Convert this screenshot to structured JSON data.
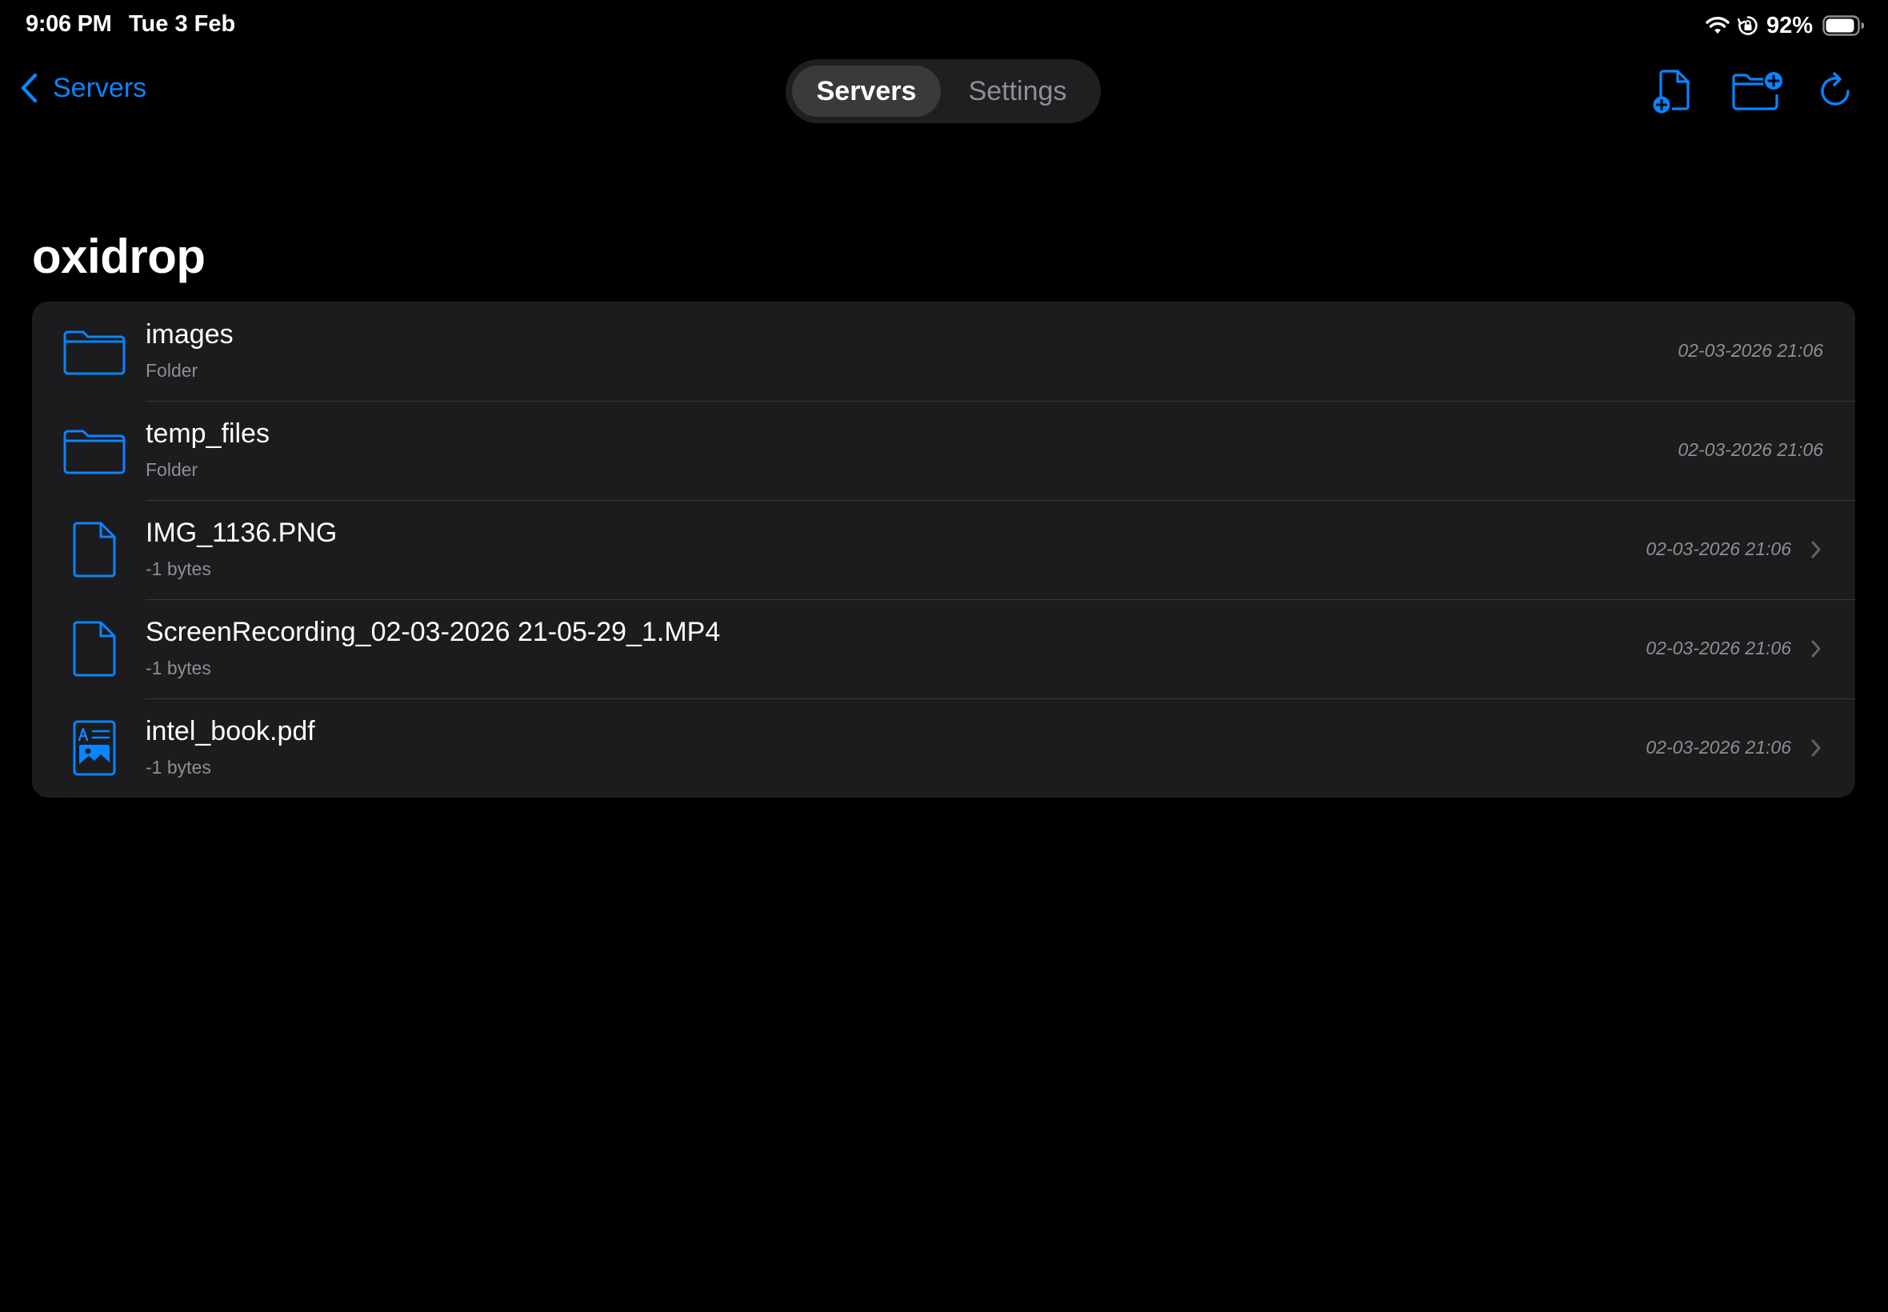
{
  "status_bar": {
    "time": "9:06 PM",
    "date": "Tue 3 Feb",
    "battery_percent": "92%",
    "icons": [
      "wifi-icon",
      "orientation-lock-icon",
      "battery-icon"
    ],
    "battery_level": 0.92
  },
  "nav": {
    "back_label": "Servers",
    "segments": [
      {
        "label": "Servers",
        "selected": true
      },
      {
        "label": "Settings",
        "selected": false
      }
    ],
    "actions": [
      "new-file-icon",
      "new-folder-icon",
      "refresh-icon"
    ]
  },
  "title": "oxidrop",
  "items": [
    {
      "name": "images",
      "subtitle": "Folder",
      "date": "02-03-2026 21:06",
      "icon": "folder-icon",
      "has_chevron": false
    },
    {
      "name": "temp_files",
      "subtitle": "Folder",
      "date": "02-03-2026 21:06",
      "icon": "folder-icon",
      "has_chevron": false
    },
    {
      "name": "IMG_1136.PNG",
      "subtitle": "-1 bytes",
      "date": "02-03-2026 21:06",
      "icon": "document-icon",
      "has_chevron": true
    },
    {
      "name": "ScreenRecording_02-03-2026 21-05-29_1.MP4",
      "subtitle": "-1 bytes",
      "date": "02-03-2026 21:06",
      "icon": "document-icon",
      "has_chevron": true
    },
    {
      "name": "intel_book.pdf",
      "subtitle": "-1 bytes",
      "date": "02-03-2026 21:06",
      "icon": "rich-document-icon",
      "has_chevron": true
    }
  ],
  "colors": {
    "accent": "#0a84ff",
    "background": "#000000",
    "list_background": "#1c1c1e",
    "secondary_text": "#8e8e93",
    "separator": "#38383a"
  }
}
